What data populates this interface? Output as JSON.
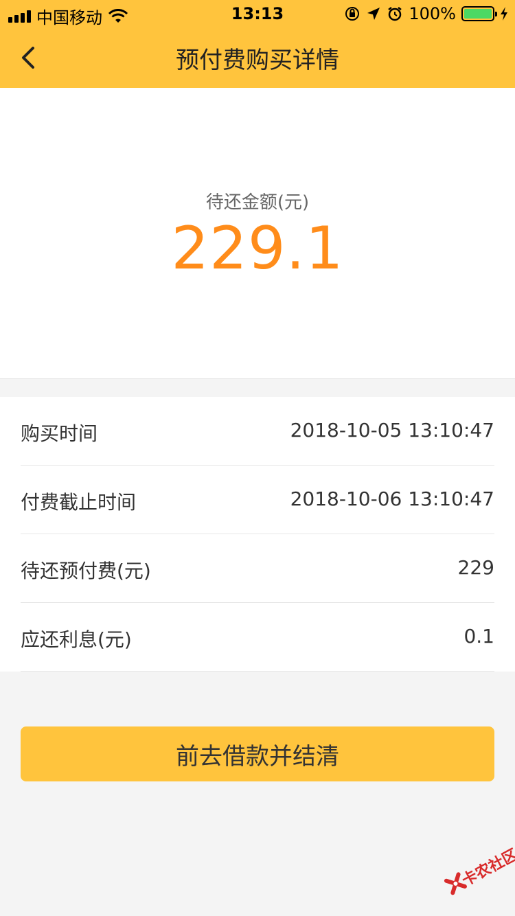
{
  "status_bar": {
    "carrier": "中国移动",
    "time": "13:13",
    "battery_percent": "100%",
    "icons": [
      "signal-icon",
      "wifi-icon",
      "orientation-lock-icon",
      "location-icon",
      "alarm-icon",
      "battery-icon",
      "charging-icon"
    ]
  },
  "header": {
    "title": "预付费购买详情",
    "back_icon": "chevron-left-icon",
    "color": "#ffc43d"
  },
  "summary": {
    "label": "待还金额(元)",
    "amount": "229.1",
    "amount_color": "#ff8c1a"
  },
  "details": [
    {
      "label": "购买时间",
      "value": "2018-10-05 13:10:47"
    },
    {
      "label": "付费截止时间",
      "value": "2018-10-06 13:10:47"
    },
    {
      "label": "待还预付费(元)",
      "value": "229"
    },
    {
      "label": "应还利息(元)",
      "value": "0.1"
    }
  ],
  "action": {
    "label": "前去借款并结清"
  },
  "watermark": {
    "text": "卡农社区"
  }
}
